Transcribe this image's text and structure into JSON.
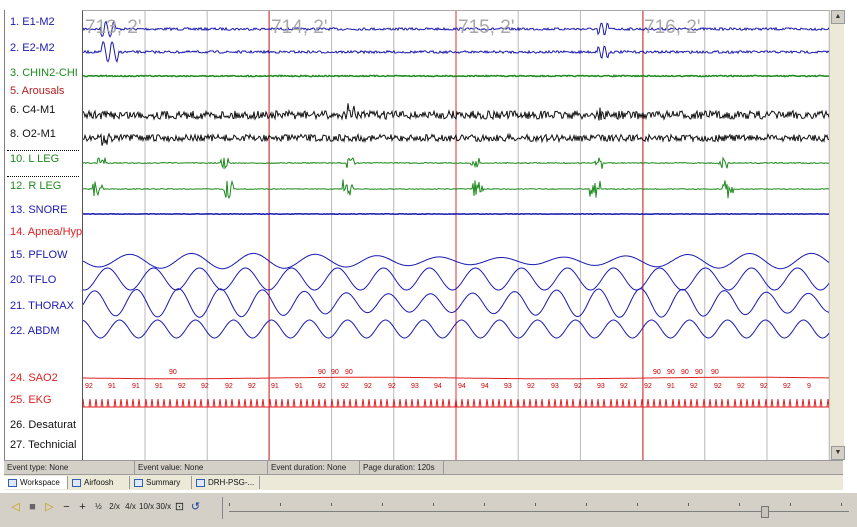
{
  "channels": [
    {
      "label": "1. E1-M2",
      "color": "#1a1ab0"
    },
    {
      "label": "2. E2-M2",
      "color": "#1a1ab0"
    },
    {
      "label": "3. CHIN2-CHI",
      "color": "#1d8a1d"
    },
    {
      "label": "5. Arousals",
      "color": "#b02020"
    },
    {
      "label": "6. C4-M1",
      "color": "#111111"
    },
    {
      "label": "8. O2-M1",
      "color": "#111111"
    },
    {
      "label": "10. L LEG",
      "color": "#1d8a1d"
    },
    {
      "label": "12. R LEG",
      "color": "#1d8a1d"
    },
    {
      "label": "13. SNORE",
      "color": "#1a1ab0"
    },
    {
      "label": "14. Apnea/Hyp",
      "color": "#e02020"
    },
    {
      "label": "15. PFLOW",
      "color": "#1a1ab0"
    },
    {
      "label": "20. TFLO",
      "color": "#1a1ab0"
    },
    {
      "label": "21. THORAX",
      "color": "#1a1ab0"
    },
    {
      "label": "22. ABDM",
      "color": "#1a1ab0"
    },
    {
      "label": "24. SAO2",
      "color": "#e02020"
    },
    {
      "label": "25. EKG",
      "color": "#e02020"
    },
    {
      "label": "26. Desaturat",
      "color": "#111111"
    },
    {
      "label": "27. Technicial",
      "color": "#111111"
    }
  ],
  "epochs": [
    "713, 2'",
    "714, 2'",
    "715, 2'",
    "716, 2'"
  ],
  "sao2_upper": [
    "90",
    "90",
    "90",
    "90",
    "90",
    "90",
    "90",
    "90",
    "90"
  ],
  "sao2_lower": [
    "92",
    "91",
    "91",
    "91",
    "92",
    "92",
    "92",
    "92",
    "91",
    "91",
    "92",
    "92",
    "92",
    "92",
    "93",
    "94",
    "94",
    "94",
    "93",
    "92",
    "93",
    "92",
    "93",
    "92",
    "92",
    "91",
    "92",
    "92",
    "92",
    "92",
    "92",
    "9"
  ],
  "status": {
    "event_type": "Event type: None",
    "event_value": "Event value: None",
    "event_duration": "Event duration: None",
    "page_duration": "Page duration: 120s"
  },
  "tabs": [
    {
      "label": "Workspace",
      "icon": "workspace-icon"
    },
    {
      "label": "Airfoosh",
      "icon": "airflow-icon"
    },
    {
      "label": "Summary",
      "icon": "summary-icon"
    },
    {
      "label": "DRH-PSG-...",
      "icon": "recording-icon"
    }
  ],
  "toolbar": {
    "buttons": [
      "◁",
      "■",
      "▷",
      "−",
      "+",
      "½",
      "2/x",
      "4/x",
      "10/x",
      "30/x",
      "⊡",
      "↺"
    ]
  },
  "colors": {
    "eog": "#1a1ab0",
    "emg": "#1d8a1d",
    "eeg": "#111111",
    "resp": "#1a1ab0",
    "sao2": "#e02020",
    "ekg": "#e02020",
    "epoch_line": "#e03030",
    "grid": "#b8b8b8"
  }
}
